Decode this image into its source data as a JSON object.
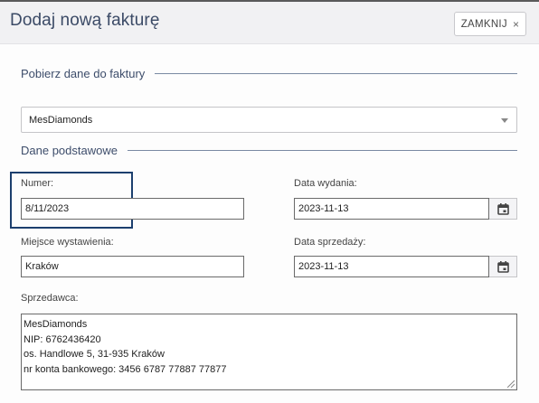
{
  "header": {
    "title": "Dodaj nową fakturę",
    "close_label": "ZAMKNIJ",
    "close_icon": "×"
  },
  "sections": {
    "fetch": "Pobierz dane do faktury",
    "basic": "Dane podstawowe"
  },
  "company_select": {
    "selected": "MesDiamonds"
  },
  "fields": {
    "number": {
      "label": "Numer:",
      "value": "8/11/2023"
    },
    "issue_date": {
      "label": "Data wydania:",
      "value": "2023-11-13"
    },
    "place": {
      "label": "Miejsce wystawienia:",
      "value": "Kraków"
    },
    "sale_date": {
      "label": "Data sprzedaży:",
      "value": "2023-11-13"
    },
    "seller": {
      "label": "Sprzedawca:",
      "lines": [
        "MesDiamonds",
        "NIP: 6762436420",
        "os. Handlowe 5, 31-935 Kraków",
        "nr konta bankowego: 3456 6787 77887 77877"
      ]
    }
  },
  "icons": {
    "calendar": "calendar-icon",
    "close": "close-icon",
    "dropdown": "chevron-down-icon"
  },
  "colors": {
    "title": "#3b4a66",
    "highlight_border": "#1c3f6e",
    "section_rule": "#7a8aa3"
  }
}
